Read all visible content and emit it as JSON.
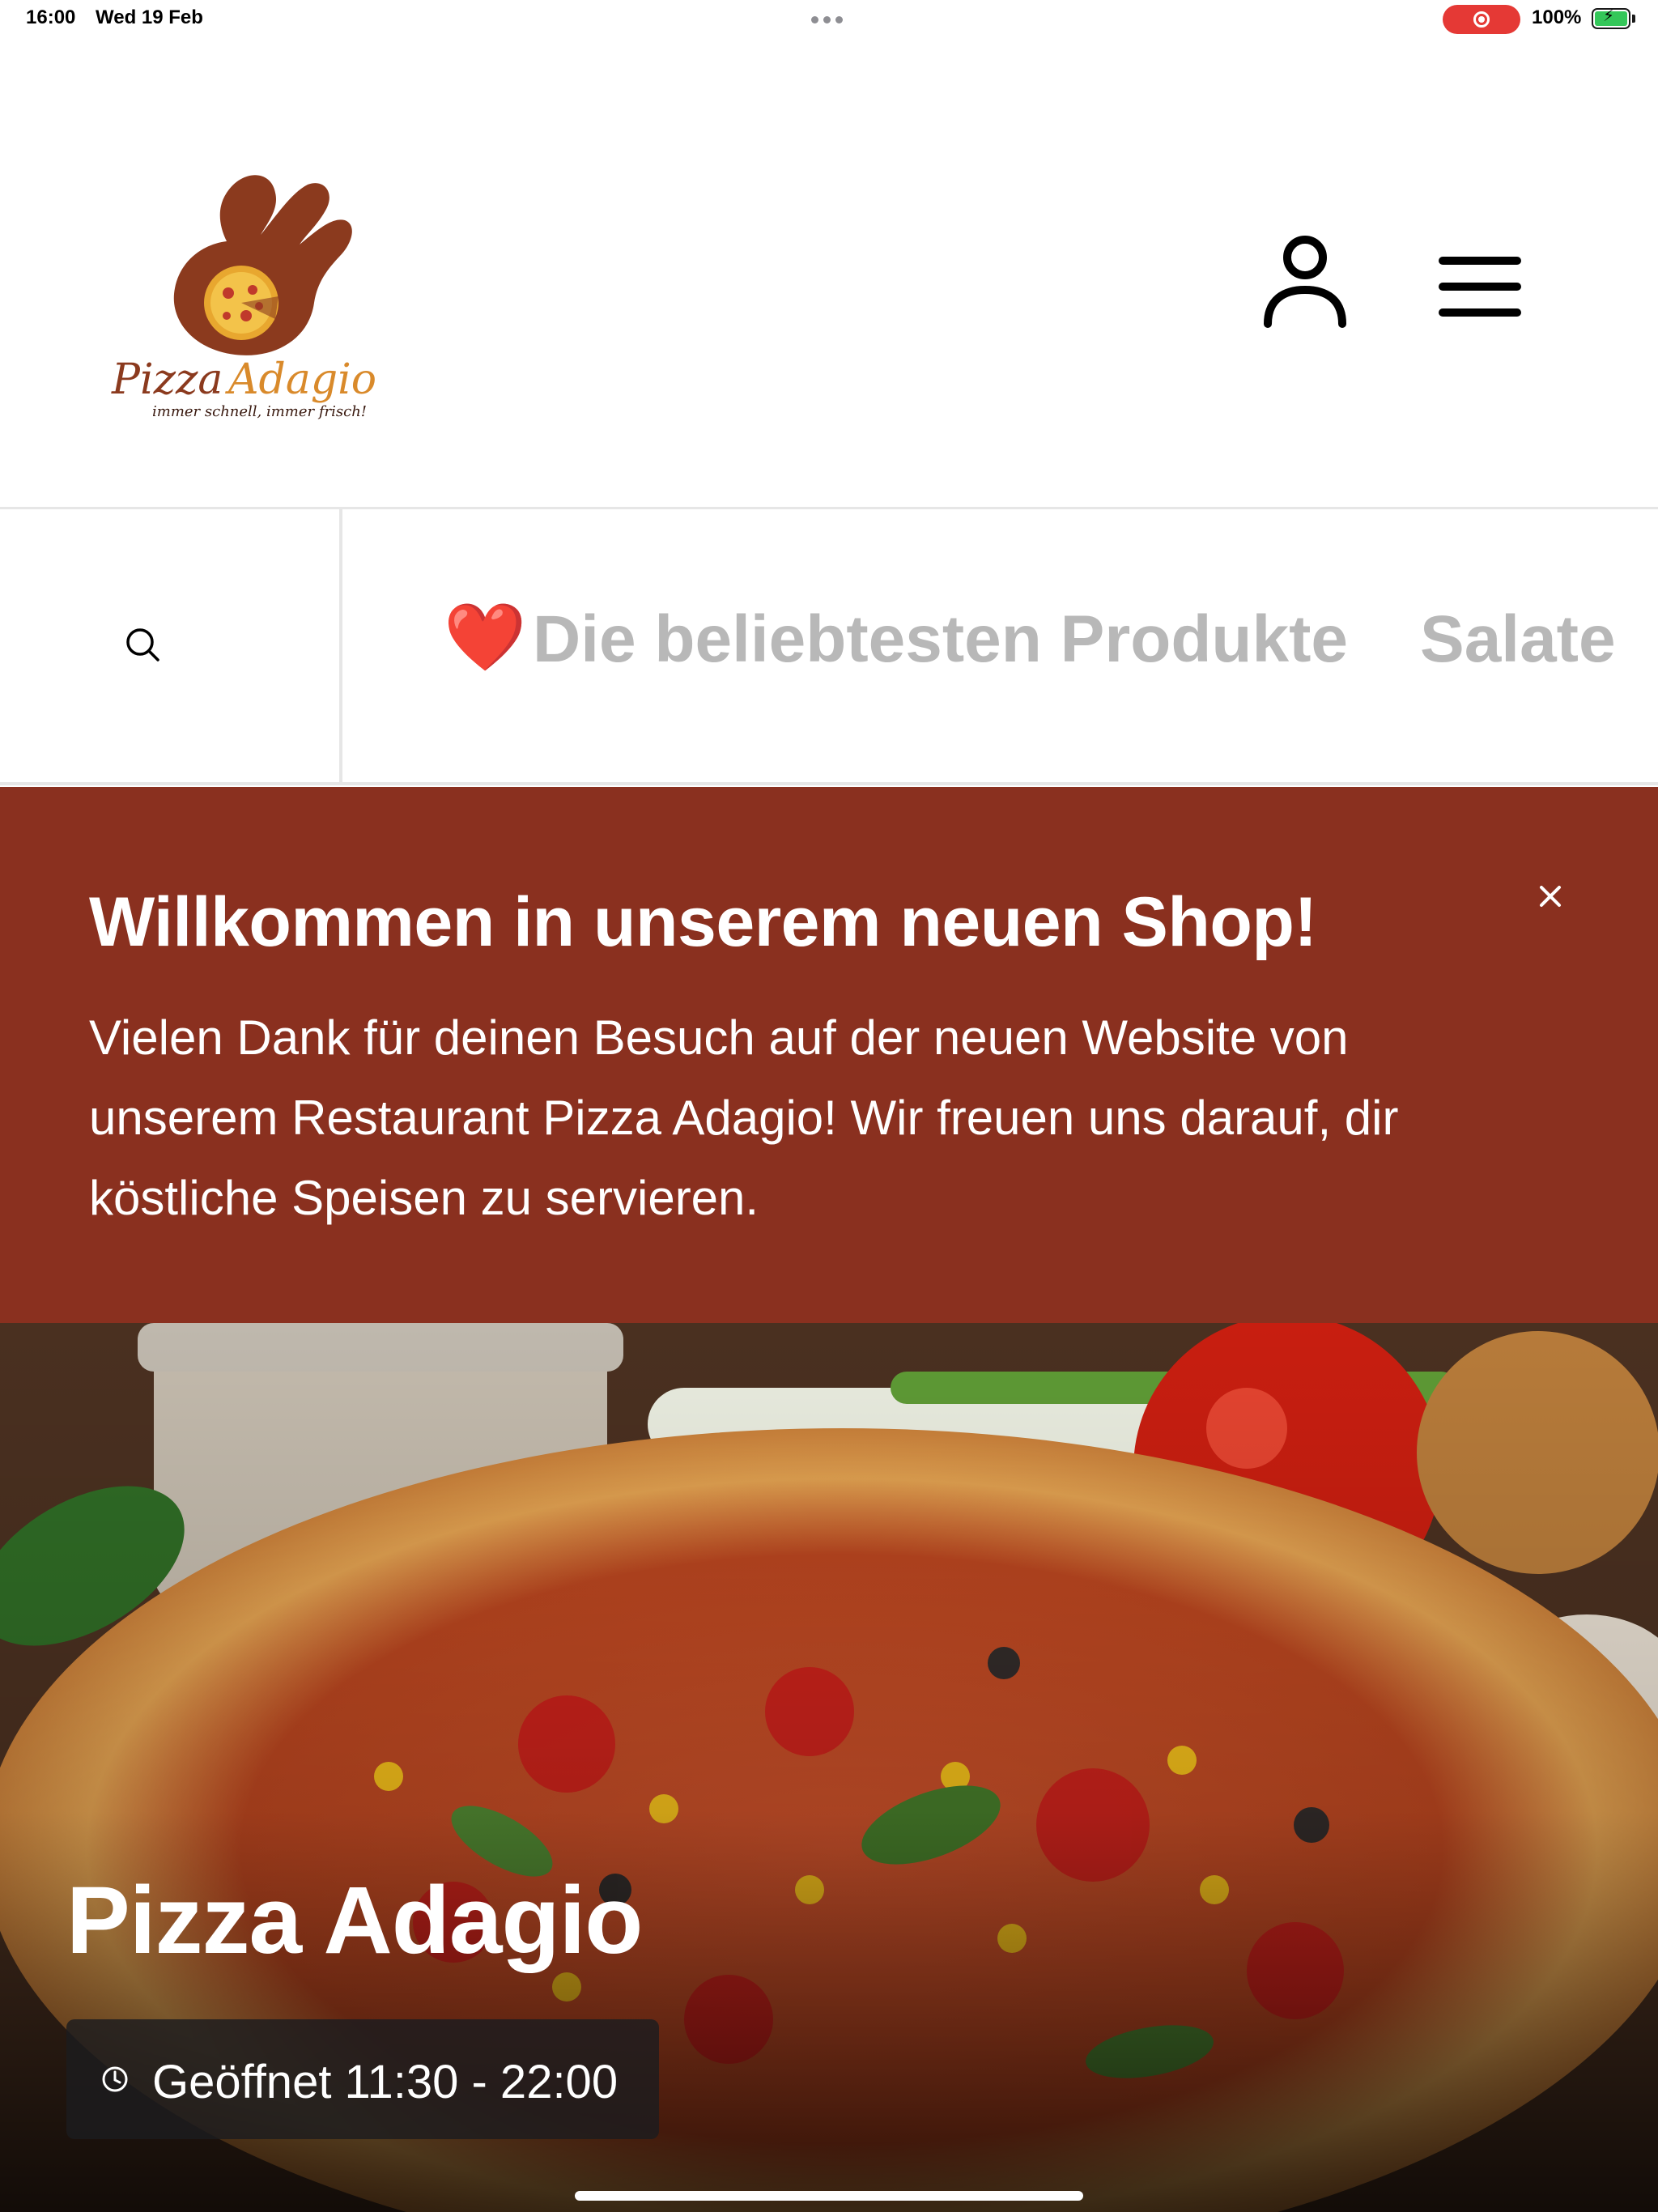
{
  "status_bar": {
    "time": "16:00",
    "date": "Wed 19 Feb",
    "battery": "100%",
    "battery_level": 1.0
  },
  "header": {
    "logo": {
      "brand_name": "Pizza Adagio",
      "tagline": "immer schnell, immer frisch!"
    },
    "account_icon": "person-icon",
    "menu_icon": "hamburger-menu-icon"
  },
  "categories": {
    "search_icon": "search-icon",
    "items": [
      {
        "emoji": "❤️",
        "label": "Die beliebtesten Produkte"
      },
      {
        "label": "Salate"
      }
    ]
  },
  "banner": {
    "title": "Willkommen in unserem neuen Shop!",
    "text": "Vielen Dank für deinen Besuch auf der neuen Website von unserem Restaurant Pizza Adagio! Wir freuen uns darauf, dir köstliche Speisen zu servieren.",
    "close_icon": "close-icon"
  },
  "hero": {
    "title": "Pizza Adagio",
    "hours": "Geöffnet 11:30 - 22:00",
    "clock_icon": "clock-icon"
  },
  "colors": {
    "banner_bg": "#8a301f",
    "category_text": "#b8b8b8",
    "logo_brown": "#8b3a1e",
    "logo_orange": "#d98a2b"
  }
}
